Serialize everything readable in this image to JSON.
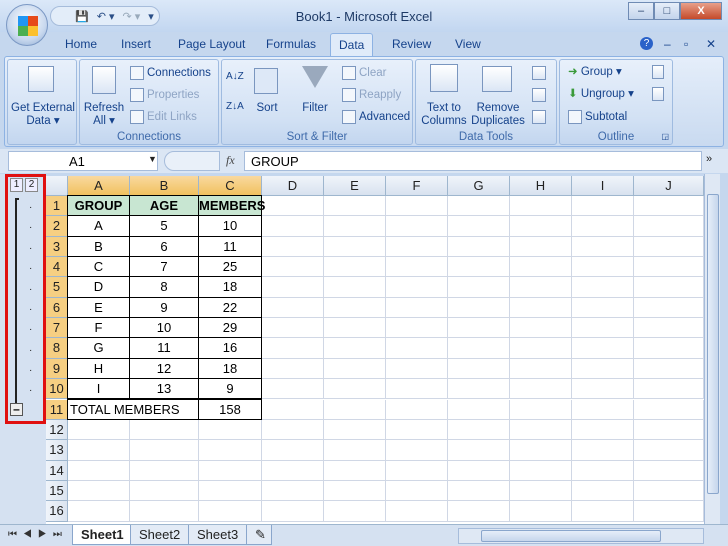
{
  "window": {
    "title": "Book1 - Microsoft Excel",
    "minimize": "–",
    "restore": "□",
    "close": "X"
  },
  "qat": {
    "save": "💾",
    "undo": "↶ ▾",
    "redo": "↷ ▾",
    "customize": "▾"
  },
  "ribbon_tabs": [
    "Home",
    "Insert",
    "Page Layout",
    "Formulas",
    "Data",
    "Review",
    "View"
  ],
  "active_tab": "Data",
  "help": "?",
  "groups": {
    "get_external": {
      "label": "Get External Data ▾"
    },
    "connections": {
      "title": "Connections",
      "refresh": "Refresh All ▾",
      "connections": "Connections",
      "properties": "Properties",
      "edit_links": "Edit Links"
    },
    "sort_filter": {
      "title": "Sort & Filter",
      "sort_az": "A↓Z",
      "sort_za": "Z↓A",
      "sort": "Sort",
      "filter": "Filter",
      "clear": "Clear",
      "reapply": "Reapply",
      "advanced": "Advanced"
    },
    "data_tools": {
      "title": "Data Tools",
      "text_to_columns": "Text to Columns",
      "remove_duplicates": "Remove Duplicates"
    },
    "outline": {
      "title": "Outline",
      "group": "Group ▾",
      "ungroup": "Ungroup ▾",
      "subtotal": "Subtotal"
    }
  },
  "formula_bar": {
    "name_box": "A1",
    "fx": "fx",
    "value": "GROUP"
  },
  "outline_levels": [
    "1",
    "2"
  ],
  "outline_collapse": "–",
  "columns": [
    "A",
    "B",
    "C",
    "D",
    "E",
    "F",
    "G",
    "H",
    "I",
    "J"
  ],
  "rows": [
    "1",
    "2",
    "3",
    "4",
    "5",
    "6",
    "7",
    "8",
    "9",
    "10",
    "11",
    "12",
    "13",
    "14",
    "15",
    "16"
  ],
  "table": {
    "header": [
      "GROUP",
      "AGE",
      "MEMBERS"
    ],
    "data": [
      [
        "A",
        "5",
        "10"
      ],
      [
        "B",
        "6",
        "11"
      ],
      [
        "C",
        "7",
        "25"
      ],
      [
        "D",
        "8",
        "18"
      ],
      [
        "E",
        "9",
        "22"
      ],
      [
        "F",
        "10",
        "29"
      ],
      [
        "G",
        "11",
        "16"
      ],
      [
        "H",
        "12",
        "18"
      ],
      [
        "I",
        "13",
        "9"
      ]
    ],
    "total_label": "TOTAL MEMBERS",
    "total_value": "158"
  },
  "sheets": [
    "Sheet1",
    "Sheet2",
    "Sheet3"
  ],
  "active_sheet": "Sheet1",
  "sheet_nav": "⏮◀▶⏭",
  "colors": {
    "header_fill": "#c8e6d2",
    "highlight": "#e01010",
    "selected_header": "#f1c15f"
  }
}
